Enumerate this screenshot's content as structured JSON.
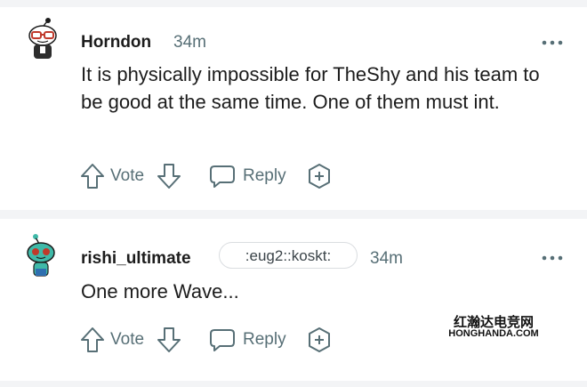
{
  "comments": [
    {
      "username": "Horndon",
      "time": "34m",
      "flair": "",
      "body": "It is physically impossible for TheShy and his team to be good at the same time. One of them must int.",
      "avatar_icon": "snoo-avatar-glasses-icon",
      "actions": {
        "vote_label": "Vote",
        "reply_label": "Reply"
      }
    },
    {
      "username": "rishi_ultimate",
      "time": "34m",
      "flair": ":eug2::koskt:",
      "body": "One more Wave...",
      "avatar_icon": "snoo-avatar-green-icon",
      "actions": {
        "vote_label": "Vote",
        "reply_label": "Reply"
      }
    }
  ],
  "watermark": {
    "line1": "红瀚达电竞网",
    "line2": "HONGHANDA.COM"
  },
  "colors": {
    "text": "#1c1c1c",
    "meta": "#576f76",
    "divider": "#f3f4f6",
    "avatar_green": "#3fb9a8"
  }
}
